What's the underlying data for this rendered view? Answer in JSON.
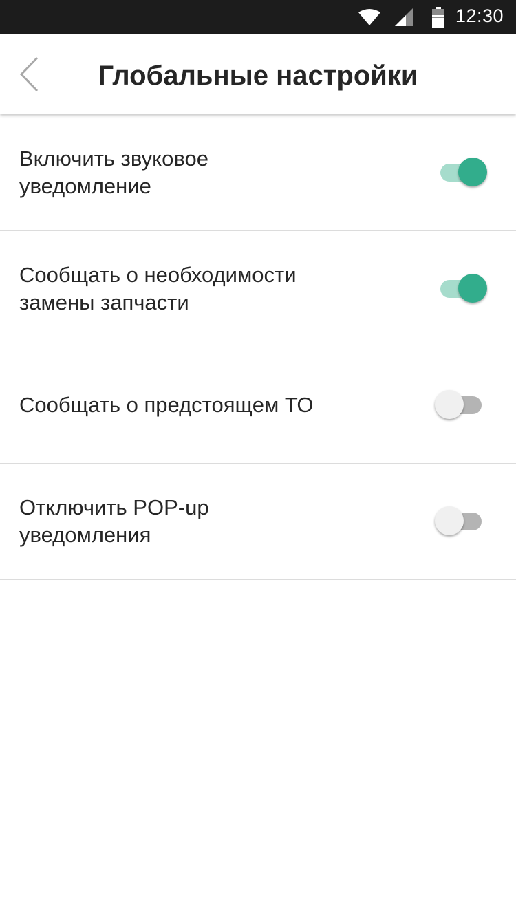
{
  "status_bar": {
    "time": "12:30",
    "icons": [
      "wifi-icon",
      "signal-icon",
      "battery-icon"
    ]
  },
  "header": {
    "title": "Глобальные настройки",
    "back_icon": "chevron-left-icon"
  },
  "colors": {
    "accent": "#32ad8c",
    "accent_track": "#a6dccc",
    "off_thumb": "#f0f0f0",
    "off_track": "#b4b4b4",
    "status_bar": "#1c1c1c"
  },
  "settings": [
    {
      "label": "Включить звуковое уведомление",
      "enabled": true
    },
    {
      "label": "Сообщать о необходимости замены запчасти",
      "enabled": true
    },
    {
      "label": "Сообщать о предстоящем ТО",
      "enabled": false
    },
    {
      "label": "Отключить POP-up уведомления",
      "enabled": false
    }
  ]
}
